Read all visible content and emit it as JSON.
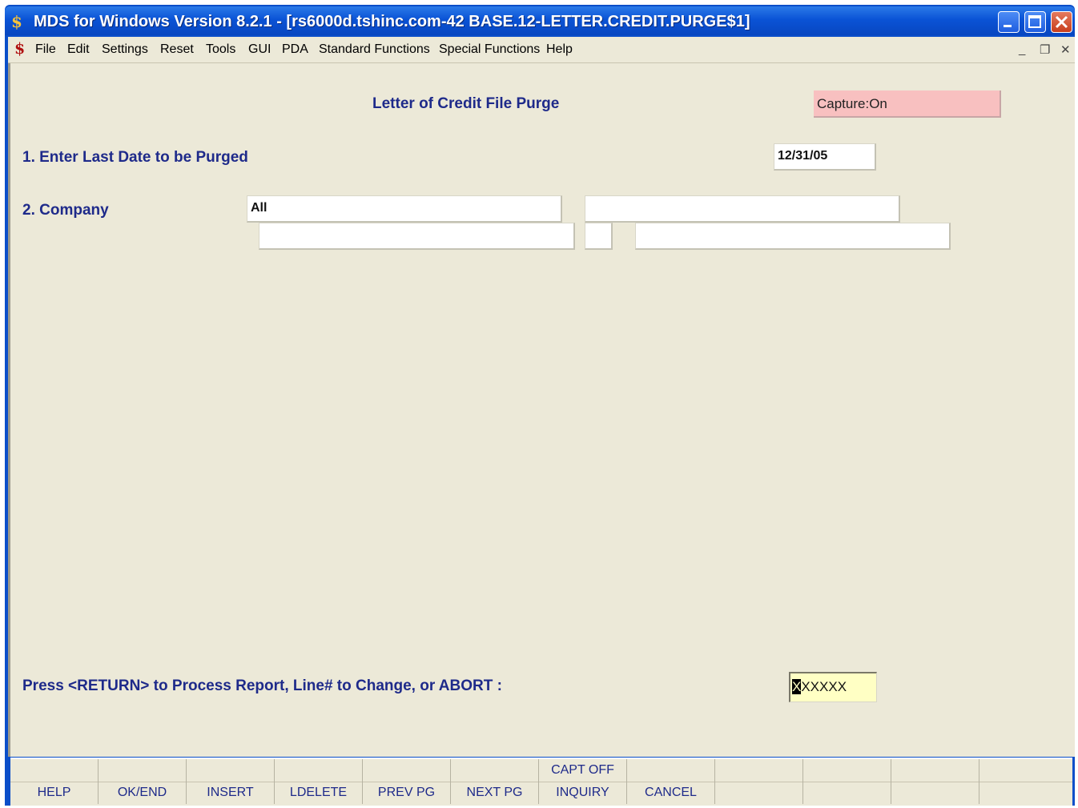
{
  "window": {
    "title": "MDS for Windows Version 8.2.1 - [rs6000d.tshinc.com-42 BASE.12-LETTER.CREDIT.PURGE$1]",
    "app_icon": "mds-dollar-icon",
    "controls": [
      "minimize",
      "maximize",
      "close"
    ]
  },
  "menu": {
    "items": [
      "File",
      "Edit",
      "Settings",
      "Reset",
      "Tools",
      "GUI",
      "PDA",
      "Standard Functions",
      "Special Functions",
      "Help"
    ],
    "mdi_controls": [
      "_",
      "❐",
      "✕"
    ]
  },
  "screen": {
    "title": "Letter of Credit File Purge",
    "capture_status": "Capture:On",
    "line1": {
      "label": "1. Enter Last Date to be Purged",
      "value": "12/31/05"
    },
    "line2": {
      "label": "2. Company",
      "value": "All",
      "desc": "",
      "row2_a": "",
      "row2_b": "",
      "row2_c": ""
    },
    "prompt": {
      "label": "Press <RETURN> to Process Report, Line# to Change, or ABORT :",
      "cursor_char": "X",
      "value_rest": "XXXXX"
    }
  },
  "function_keys": [
    {
      "top": "",
      "bottom": "HELP"
    },
    {
      "top": "",
      "bottom": "OK/END"
    },
    {
      "top": "",
      "bottom": "INSERT"
    },
    {
      "top": "",
      "bottom": "LDELETE"
    },
    {
      "top": "",
      "bottom": "PREV PG"
    },
    {
      "top": "",
      "bottom": "NEXT PG"
    },
    {
      "top": "CAPT OFF",
      "bottom": "INQUIRY"
    },
    {
      "top": "",
      "bottom": "CANCEL"
    },
    {
      "top": "",
      "bottom": ""
    },
    {
      "top": "",
      "bottom": ""
    },
    {
      "top": "",
      "bottom": ""
    },
    {
      "top": "",
      "bottom": ""
    }
  ],
  "colors": {
    "title_bar": "#0a53d6",
    "background": "#ece9d8",
    "label_text": "#1e2a8a",
    "capture_bg": "#f8c0c0",
    "prompt_bg": "#ffffc4"
  }
}
